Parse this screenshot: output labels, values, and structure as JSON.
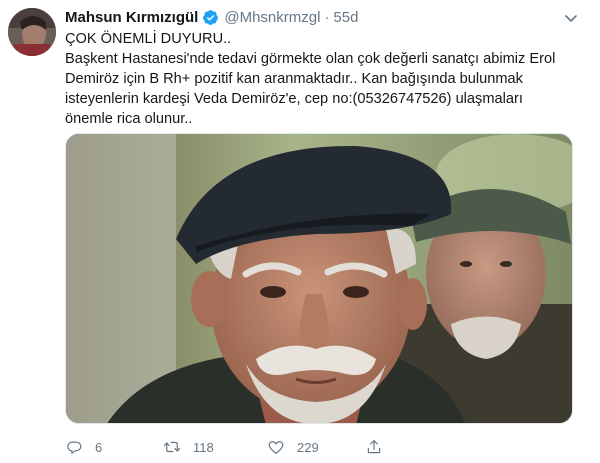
{
  "tweet": {
    "author_name": "Mahsun Kırmızıgül",
    "handle": "@Mhsnkrmzgl",
    "separator": "·",
    "timestamp": "55d",
    "lines": [
      "ÇOK ÖNEMLİ DUYURU..",
      "Başkent Hastanesi'nde tedavi görmekte olan çok değerli sanatçı abimiz Erol",
      "Demiröz için B Rh+ pozitif kan aranmaktadır.. Kan bağışında bulunmak",
      "isteyenlerin kardeşi Veda Demiröz'e, cep no:(05326747526) ulaşmaları",
      "önemle rica olunur.."
    ]
  },
  "actions": {
    "reply_count": "6",
    "retweet_count": "118",
    "like_count": "229"
  },
  "icons": {
    "verified": "verified-badge-icon",
    "caret": "chevron-down-icon",
    "reply": "reply-icon",
    "retweet": "retweet-icon",
    "like": "heart-icon",
    "share": "share-icon"
  },
  "colors": {
    "verified_blue": "#1da1f2",
    "muted_text": "#657786",
    "primary_text": "#14171a"
  }
}
